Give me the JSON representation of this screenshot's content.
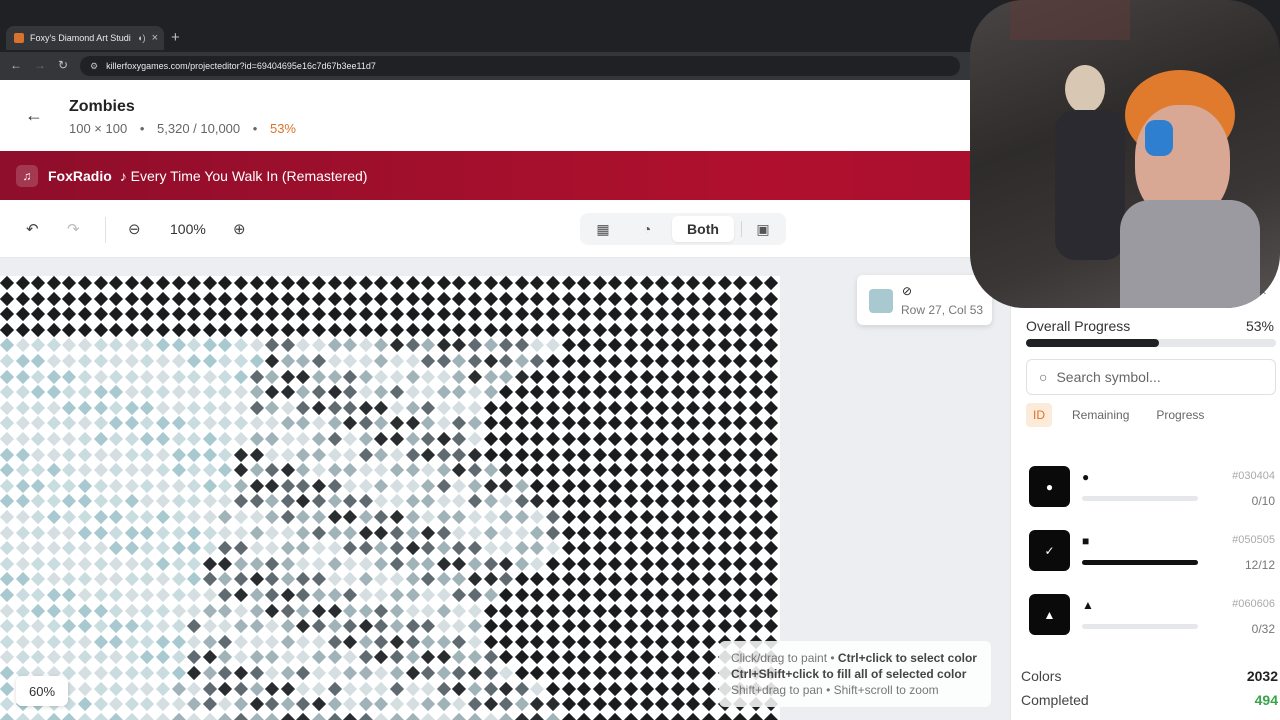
{
  "browser": {
    "tab_title": "Foxy's Diamond Art Studio",
    "tab_close": "×",
    "new_tab": "+",
    "window_close": "×",
    "url": "killerfoxygames.com/projecteditor?id=69404695e16c7d67b3ee11d7"
  },
  "project": {
    "title": "Zombies",
    "dimensions": "100 × 100",
    "placed": "5,320 / 10,000",
    "percent": "53%",
    "separator": "•"
  },
  "radio": {
    "icon": "♫",
    "name": "FoxRadio",
    "track": "♪ Every Time You Walk In (Remastered)"
  },
  "toolbar": {
    "zoom": "100%",
    "view_mode": "Both"
  },
  "canvas": {
    "tooltip": {
      "symbol": "⊘",
      "position": "Row 27, Col 53",
      "swatch": "#a7c9cf"
    },
    "hint": {
      "line1_a": "Click/drag to paint • ",
      "line1_b": "Ctrl+click to select color",
      "line2": "Ctrl+Shift+click to fill all of selected color",
      "line3": "Shift+drag to pan • Shift+scroll to zoom"
    },
    "mini_zoom": "60%"
  },
  "panel": {
    "overall_label": "Overall Progress",
    "overall_pct": "53%",
    "overall_fraction": 0.53,
    "search_placeholder": "Search symbol...",
    "sort_tabs": [
      "ID",
      "Remaining",
      "Progress"
    ],
    "colors": [
      {
        "symbol": "●",
        "code": "#030404",
        "count": "0/10",
        "progress": 0.0
      },
      {
        "symbol": "■",
        "code": "#050505",
        "count": "12/12",
        "progress": 1.0
      },
      {
        "symbol": "▲",
        "code": "#060606",
        "count": "0/32",
        "progress": 0.0
      }
    ],
    "stats": [
      {
        "label": "Colors",
        "value": "2032"
      },
      {
        "label": "Completed",
        "value": "494"
      }
    ]
  },
  "theme": {
    "accent": "#d9722c",
    "radio_bar": "#b0102d",
    "done_green": "#3aa34a"
  }
}
